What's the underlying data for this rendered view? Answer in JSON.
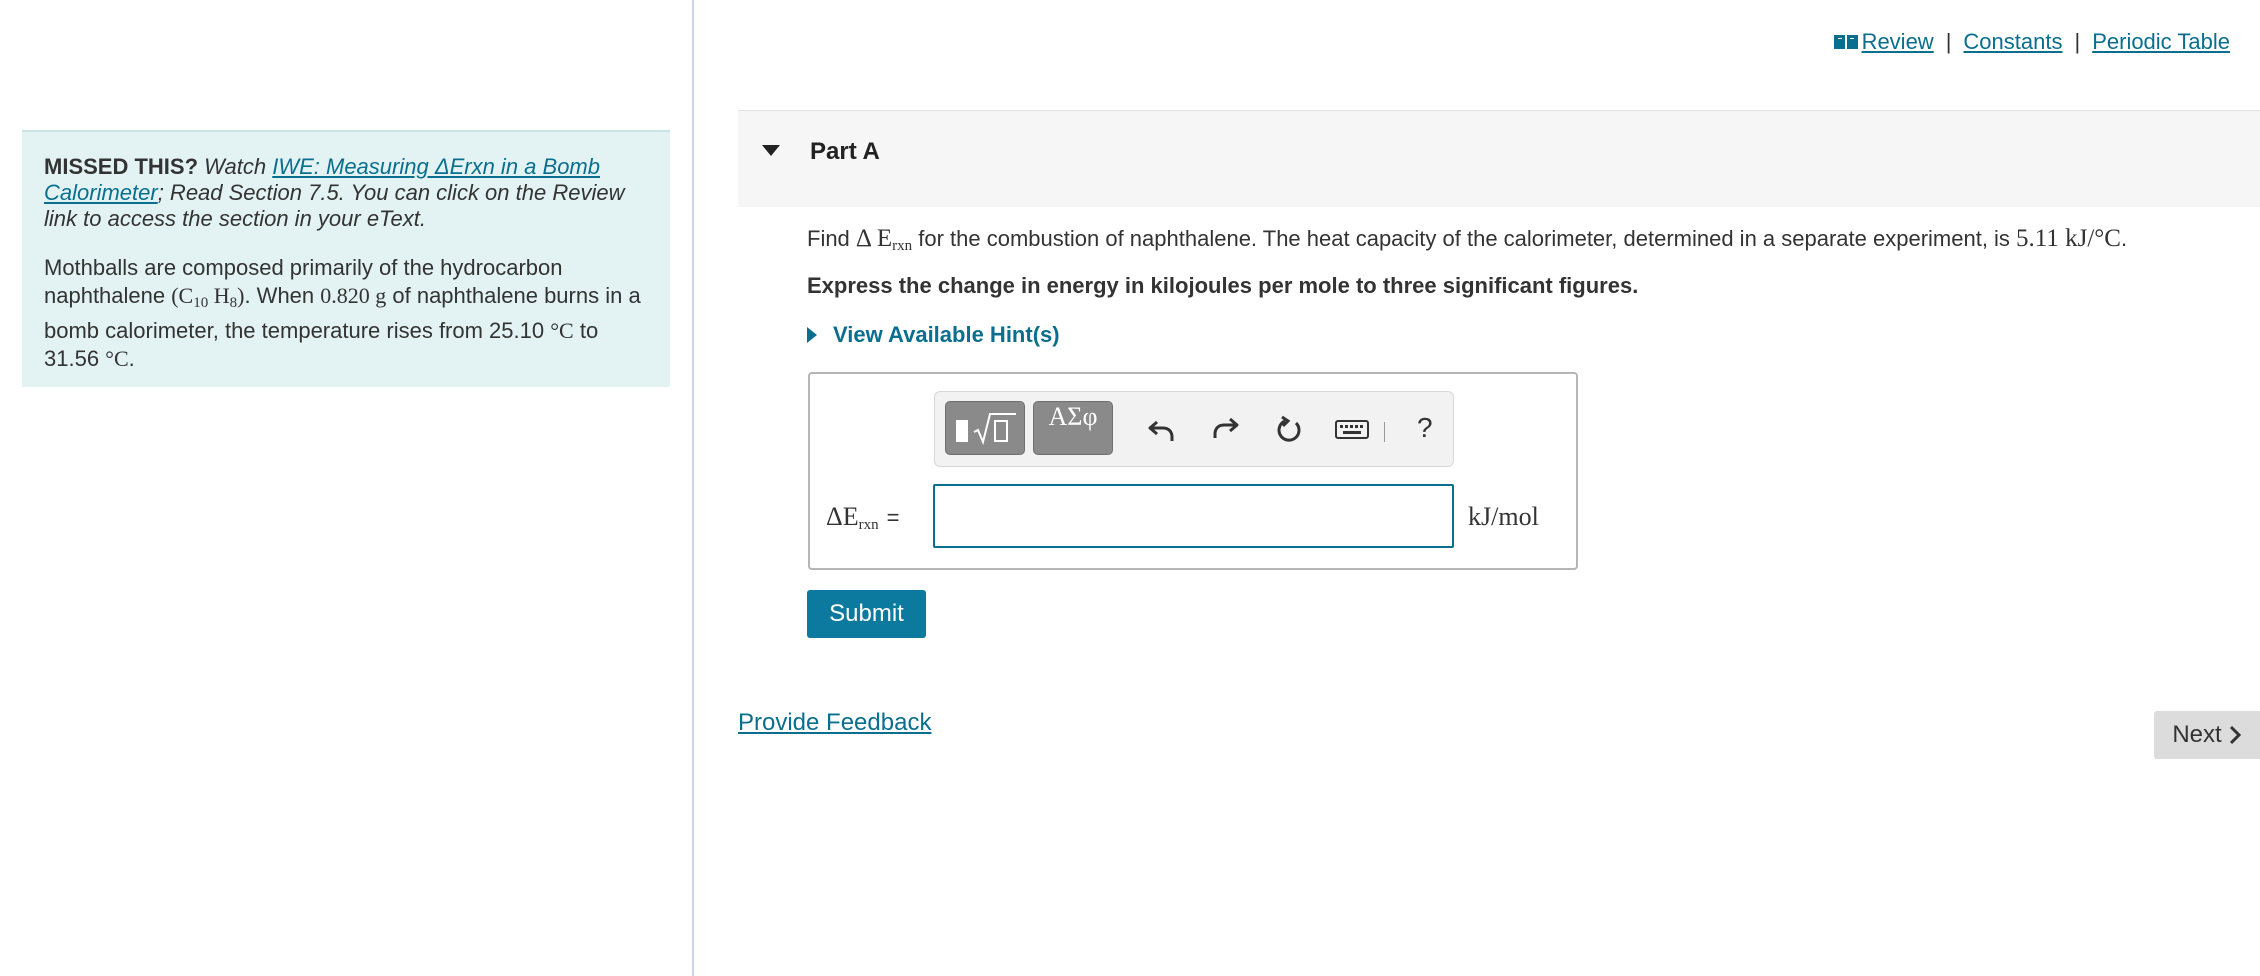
{
  "top_links": {
    "review": "Review",
    "separator": "|",
    "constants": "Constants",
    "periodic_table": "Periodic Table"
  },
  "info_panel": {
    "missed_label": "MISSED THIS?",
    "watch_text": "Watch",
    "video_link": "IWE: Measuring ΔErxn in a Bomb Calorimeter",
    "read_text": "; Read Section 7.5. You can click on the Review link to access the section in your eText.",
    "problem_part1": "Mothballs are composed primarily of the hydrocarbon naphthalene ",
    "formula_C": "(C",
    "formula_C_sub": "10",
    "formula_H": " H",
    "formula_H_sub": "8",
    "formula_close": ")",
    "problem_part2": ". When ",
    "mass": "0.820 g",
    "problem_part3": " of naphthalene burns in a bomb calorimeter, the temperature rises from 25.10 ",
    "temp_unit_1": "°C",
    "problem_part4": " to 31.56 ",
    "temp_unit_2": "°C",
    "problem_end": "."
  },
  "part": {
    "title": "Part A"
  },
  "question": {
    "find": "Find ",
    "delta_e": "Δ E",
    "rxn_sub": "rxn",
    "body": " for the combustion of naphthalene. The heat capacity of the calorimeter, determined in a separate experiment, is ",
    "heat_capacity": "5.11 kJ/°C",
    "end": "."
  },
  "instruction": "Express the change in energy in kilojoules per mole to three significant figures.",
  "hints_label": "View Available Hint(s)",
  "toolbar": {
    "symbols_label": "ΑΣφ",
    "help_label": "?"
  },
  "answer": {
    "delta_e": "ΔE",
    "rxn_sub": "rxn",
    "equals": "=",
    "value": "",
    "unit": "kJ/mol"
  },
  "submit_label": "Submit",
  "feedback_label": "Provide Feedback",
  "next_label": "Next"
}
